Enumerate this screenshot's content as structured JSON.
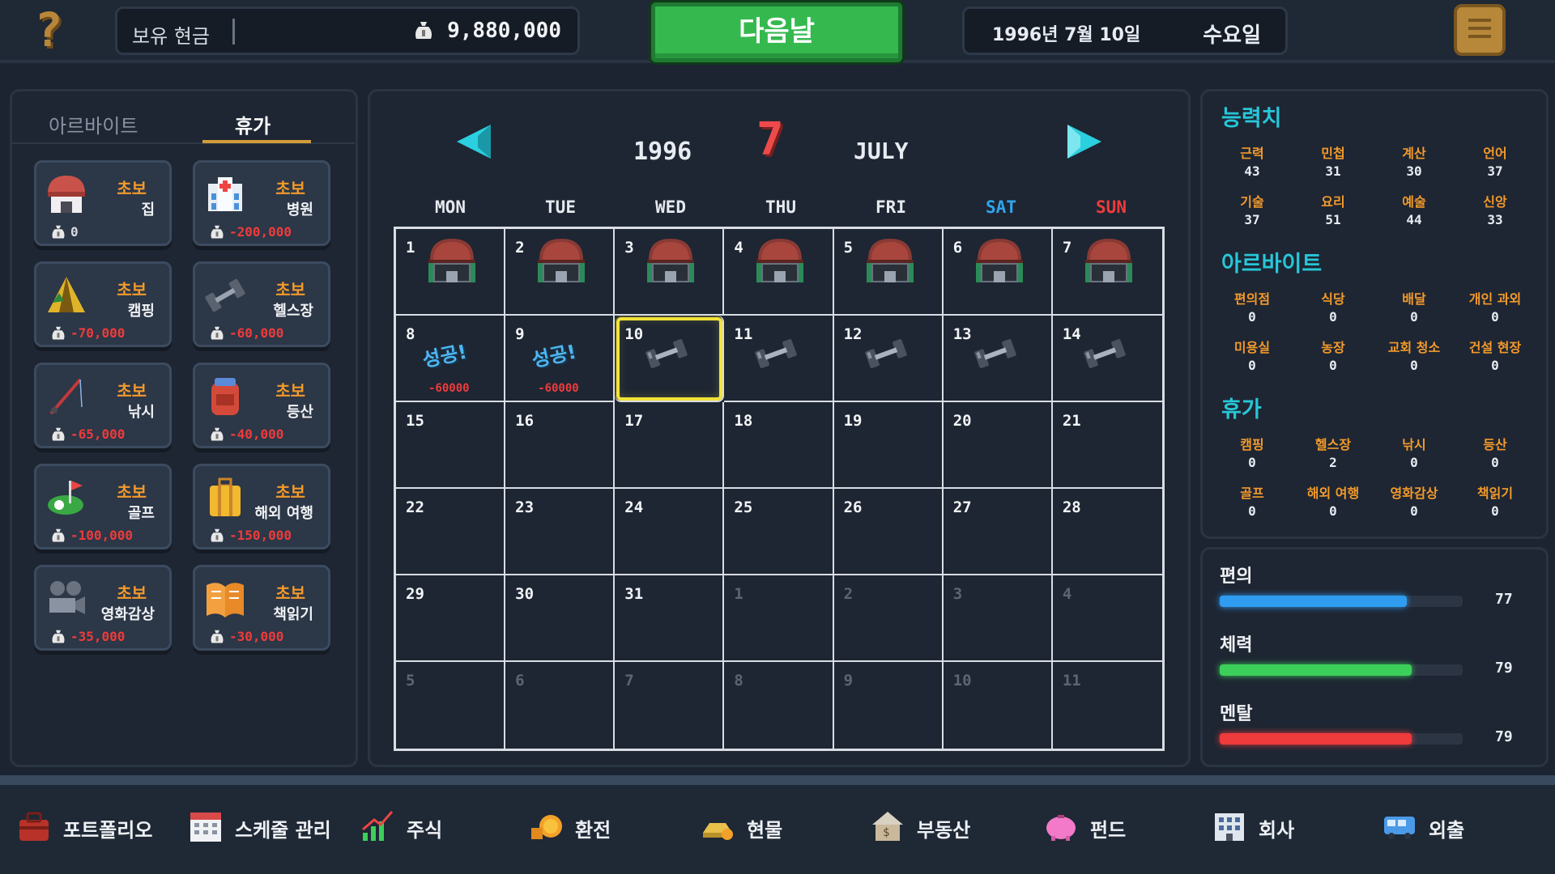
{
  "header": {
    "help_icon": "?",
    "cash_label": "보유 현금",
    "cash_value": "9,880,000",
    "next_day_label": "다음날",
    "date_text": "1996년 7월 10일",
    "weekday_text": "수요일"
  },
  "left_panel": {
    "tabs": [
      {
        "label": "아르바이트",
        "active": false
      },
      {
        "label": "휴가",
        "active": true
      }
    ],
    "activities": [
      {
        "level": "초보",
        "name": "집",
        "cost": "0",
        "icon": "house-icon"
      },
      {
        "level": "초보",
        "name": "병원",
        "cost": "-200,000",
        "icon": "hospital-icon"
      },
      {
        "level": "초보",
        "name": "캠핑",
        "cost": "-70,000",
        "icon": "tent-icon"
      },
      {
        "level": "초보",
        "name": "헬스장",
        "cost": "-60,000",
        "icon": "dumbbell-icon"
      },
      {
        "level": "초보",
        "name": "낚시",
        "cost": "-65,000",
        "icon": "fishing-rod-icon"
      },
      {
        "level": "초보",
        "name": "등산",
        "cost": "-40,000",
        "icon": "backpack-icon"
      },
      {
        "level": "초보",
        "name": "골프",
        "cost": "-100,000",
        "icon": "golf-icon"
      },
      {
        "level": "초보",
        "name": "해외 여행",
        "cost": "-150,000",
        "icon": "suitcase-icon"
      },
      {
        "level": "초보",
        "name": "영화감상",
        "cost": "-35,000",
        "icon": "film-camera-icon"
      },
      {
        "level": "초보",
        "name": "책읽기",
        "cost": "-30,000",
        "icon": "book-icon"
      }
    ]
  },
  "calendar": {
    "year": "1996",
    "month_number": "7",
    "month_name": "JULY",
    "weekdays": [
      "MON",
      "TUE",
      "WED",
      "THU",
      "FRI",
      "SAT",
      "SUN"
    ],
    "weekday_colors": [
      "#e6e9ee",
      "#e6e9ee",
      "#e6e9ee",
      "#e6e9ee",
      "#e6e9ee",
      "#2fa6ee",
      "#ee3b3b"
    ],
    "success_text": "성공!",
    "penalty_text": "-60000",
    "today": "10",
    "days": [
      {
        "d": "1",
        "icon": "house"
      },
      {
        "d": "2",
        "icon": "house"
      },
      {
        "d": "3",
        "icon": "house"
      },
      {
        "d": "4",
        "icon": "house"
      },
      {
        "d": "5",
        "icon": "house"
      },
      {
        "d": "6",
        "icon": "house"
      },
      {
        "d": "7",
        "icon": "house"
      },
      {
        "d": "8",
        "icon": "success"
      },
      {
        "d": "9",
        "icon": "success"
      },
      {
        "d": "10",
        "icon": "dumbbell",
        "today": true
      },
      {
        "d": "11",
        "icon": "dumbbell"
      },
      {
        "d": "12",
        "icon": "dumbbell"
      },
      {
        "d": "13",
        "icon": "dumbbell"
      },
      {
        "d": "14",
        "icon": "dumbbell"
      },
      {
        "d": "15"
      },
      {
        "d": "16"
      },
      {
        "d": "17"
      },
      {
        "d": "18"
      },
      {
        "d": "19"
      },
      {
        "d": "20"
      },
      {
        "d": "21"
      },
      {
        "d": "22"
      },
      {
        "d": "23"
      },
      {
        "d": "24"
      },
      {
        "d": "25"
      },
      {
        "d": "26"
      },
      {
        "d": "27"
      },
      {
        "d": "28"
      },
      {
        "d": "29"
      },
      {
        "d": "30"
      },
      {
        "d": "31"
      },
      {
        "d": "1",
        "dim": true
      },
      {
        "d": "2",
        "dim": true
      },
      {
        "d": "3",
        "dim": true
      },
      {
        "d": "4",
        "dim": true
      },
      {
        "d": "5",
        "dim": true
      },
      {
        "d": "6",
        "dim": true
      },
      {
        "d": "7",
        "dim": true
      },
      {
        "d": "8",
        "dim": true
      },
      {
        "d": "9",
        "dim": true
      },
      {
        "d": "10",
        "dim": true
      },
      {
        "d": "11",
        "dim": true
      }
    ]
  },
  "stats": {
    "ability_title": "능력치",
    "ability": [
      {
        "label": "근력",
        "value": "43"
      },
      {
        "label": "민첩",
        "value": "31"
      },
      {
        "label": "계산",
        "value": "30"
      },
      {
        "label": "언어",
        "value": "37"
      },
      {
        "label": "기술",
        "value": "37"
      },
      {
        "label": "요리",
        "value": "51"
      },
      {
        "label": "예술",
        "value": "44"
      },
      {
        "label": "신앙",
        "value": "33"
      }
    ],
    "alba_title": "아르바이트",
    "alba": [
      {
        "label": "편의점",
        "value": "0"
      },
      {
        "label": "식당",
        "value": "0"
      },
      {
        "label": "배달",
        "value": "0"
      },
      {
        "label": "개인 과외",
        "value": "0"
      },
      {
        "label": "미용실",
        "value": "0"
      },
      {
        "label": "농장",
        "value": "0"
      },
      {
        "label": "교회 청소",
        "value": "0"
      },
      {
        "label": "건설 현장",
        "value": "0"
      }
    ],
    "vacation_title": "휴가",
    "vacation": [
      {
        "label": "캠핑",
        "value": "0"
      },
      {
        "label": "헬스장",
        "value": "2"
      },
      {
        "label": "낚시",
        "value": "0"
      },
      {
        "label": "등산",
        "value": "0"
      },
      {
        "label": "골프",
        "value": "0"
      },
      {
        "label": "해외 여행",
        "value": "0"
      },
      {
        "label": "영화감상",
        "value": "0"
      },
      {
        "label": "책읽기",
        "value": "0"
      }
    ]
  },
  "gauges": [
    {
      "label": "편의",
      "value": "77",
      "fraction": 0.77,
      "color": "#2f9cf0"
    },
    {
      "label": "체력",
      "value": "79",
      "fraction": 0.79,
      "color": "#3ccf5a"
    },
    {
      "label": "멘탈",
      "value": "79",
      "fraction": 0.79,
      "color": "#ee3b3b"
    }
  ],
  "bottom_nav": [
    {
      "label": "포트폴리오",
      "icon": "portfolio-icon"
    },
    {
      "label": "스케줄 관리",
      "icon": "calendar-icon"
    },
    {
      "label": "주식",
      "icon": "stock-chart-icon"
    },
    {
      "label": "환전",
      "icon": "coins-icon"
    },
    {
      "label": "현물",
      "icon": "gold-bar-icon"
    },
    {
      "label": "부동산",
      "icon": "house-dollar-icon"
    },
    {
      "label": "펀드",
      "icon": "piggy-bank-icon"
    },
    {
      "label": "회사",
      "icon": "building-icon"
    },
    {
      "label": "외출",
      "icon": "bus-icon"
    }
  ]
}
